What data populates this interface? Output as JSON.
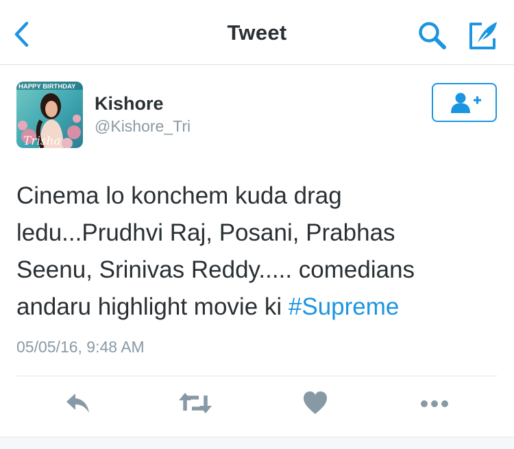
{
  "navbar": {
    "title": "Tweet",
    "back_icon": "chevron-left-icon",
    "search_icon": "search-icon",
    "compose_icon": "compose-icon",
    "accent_color": "#1b95e0"
  },
  "author": {
    "name": "Kishore",
    "handle": "@Kishore_Tri",
    "avatar_caption": "HAPPY BIRTHDAY",
    "avatar_signature": "Trisha",
    "follow_icon": "add-user-icon"
  },
  "tweet": {
    "lines": [
      "Cinema lo konchem kuda drag",
      "ledu...Prudhvi Raj, Posani, Prabhas",
      "Seenu, Srinivas Reddy..... comedians",
      "andaru highlight movie ki "
    ],
    "hashtag": "#Supreme",
    "timestamp": "05/05/16, 9:48 AM"
  },
  "actions": [
    {
      "name": "reply",
      "icon": "reply-icon"
    },
    {
      "name": "retweet",
      "icon": "retweet-icon"
    },
    {
      "name": "like",
      "icon": "heart-icon"
    },
    {
      "name": "more",
      "icon": "more-dots-icon"
    }
  ],
  "colors": {
    "icon_gray": "#8899a6",
    "text": "#292f33",
    "link": "#1b95e0"
  }
}
